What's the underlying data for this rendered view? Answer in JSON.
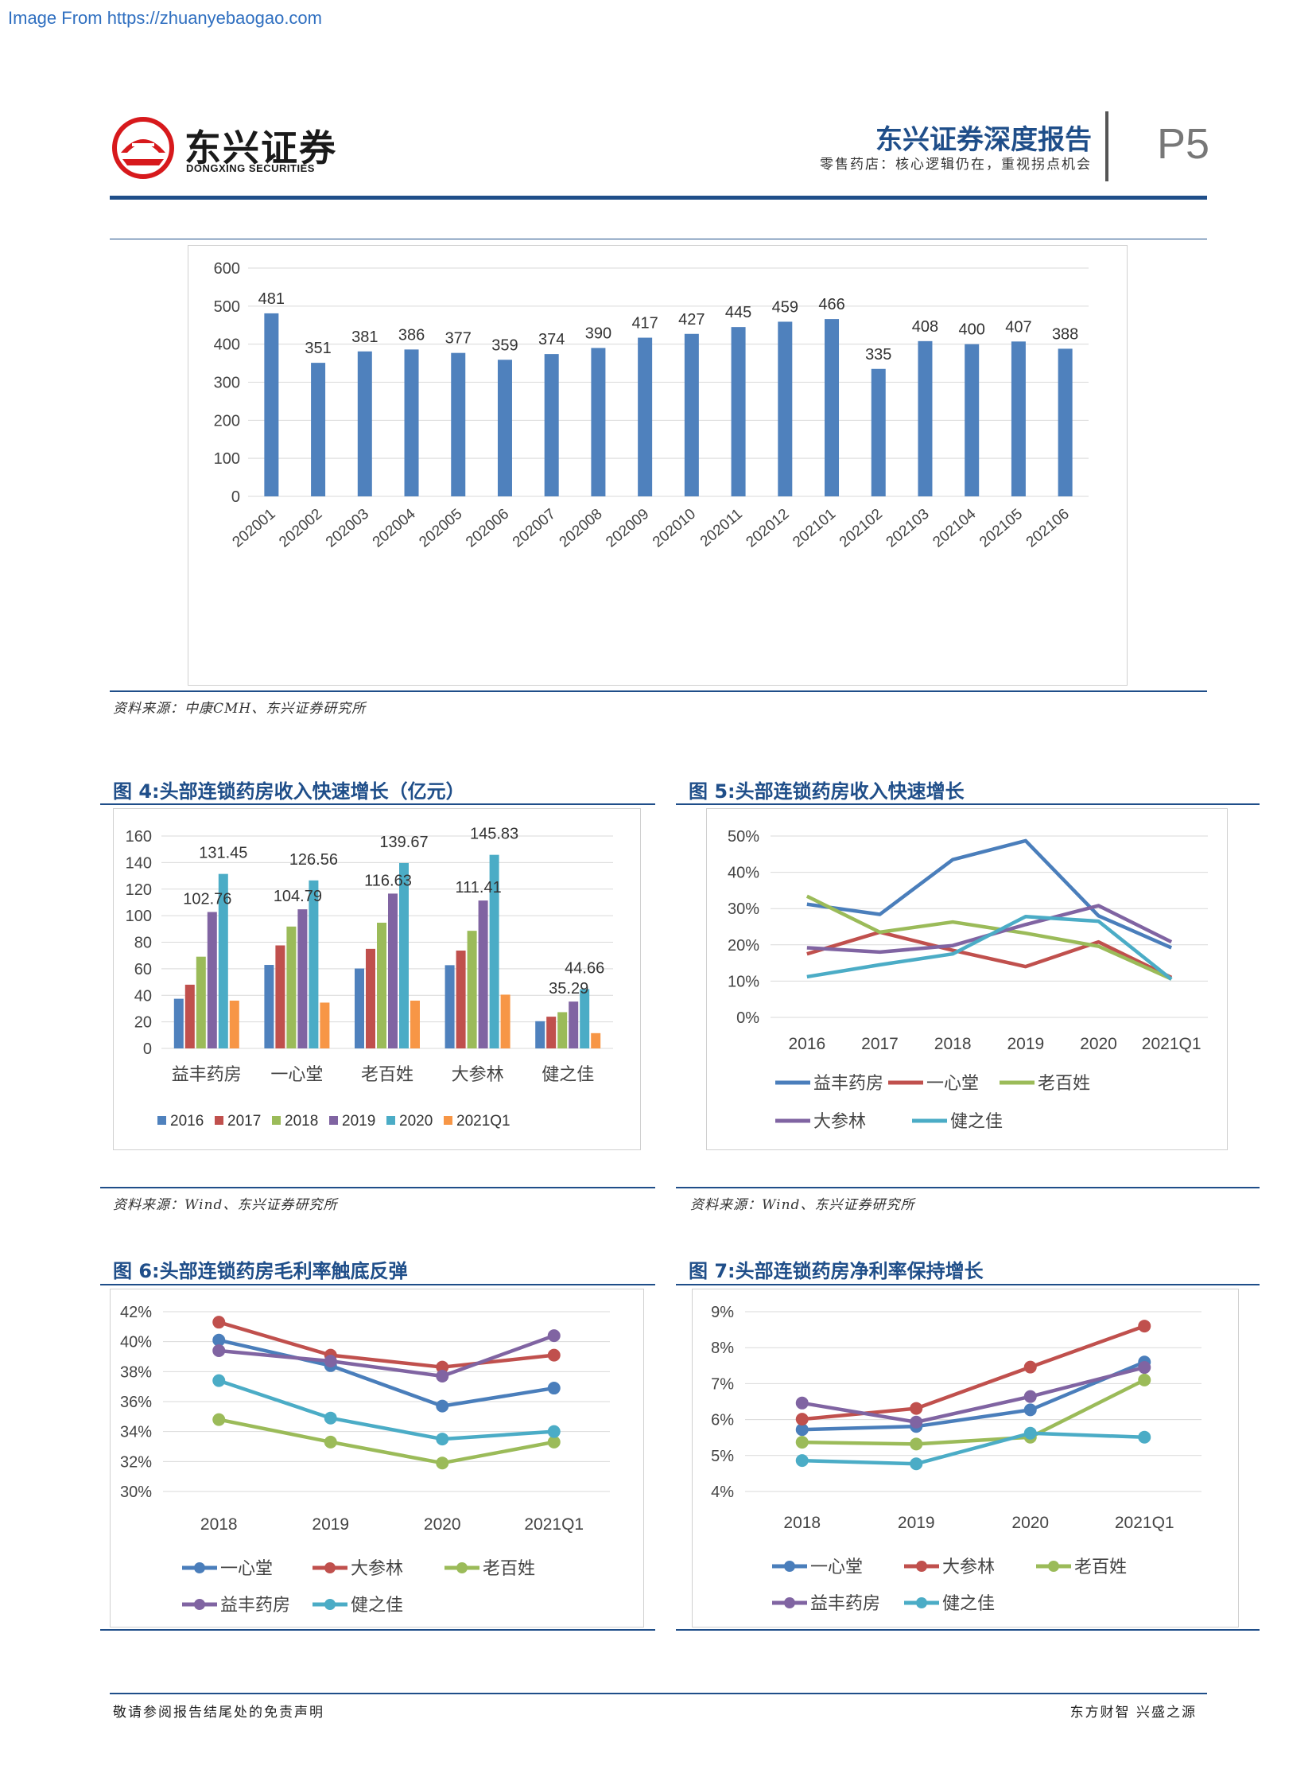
{
  "watermark": "Image From https://zhuanyebaogao.com",
  "header": {
    "logo_cn": "东兴证券",
    "logo_en": "DONGXING SECURITIES",
    "report_title": "东兴证券深度报告",
    "report_subtitle": "零售药店：核心逻辑仍在，重视拐点机会",
    "page": "P5",
    "logo_color": "#d7191c"
  },
  "colors": {
    "accent": "#1f4e89",
    "bar_blue": "#4f81bd",
    "s2016": "#4f81bd",
    "s2017": "#c0504d",
    "s2018": "#9bbb59",
    "s2019": "#8064a2",
    "s2020": "#4bacc6",
    "s2021": "#f79646",
    "line_blue": "#4a7ebb",
    "line_red": "#c0504d",
    "line_green": "#9bbb59",
    "line_purple": "#8064a2",
    "line_teal": "#4bacc6"
  },
  "figures": {
    "fig3": {
      "source": "资料来源：中康CMH、东兴证券研究所"
    },
    "fig4": {
      "title": "图 4:头部连锁药房收入快速增长（亿元）",
      "source": "资料来源：Wind、东兴证券研究所"
    },
    "fig5": {
      "title": "图 5:头部连锁药房收入快速增长",
      "source": "资料来源：Wind、东兴证券研究所"
    },
    "fig6": {
      "title": "图 6:头部连锁药房毛利率触底反弹"
    },
    "fig7": {
      "title": "图 7:头部连锁药房净利率保持增长"
    }
  },
  "footer": {
    "left": "敬请参阅报告结尾处的免责声明",
    "right": "东方财智 兴盛之源"
  },
  "chart_data": [
    {
      "id": "fig3",
      "type": "bar",
      "categories": [
        "202001",
        "202002",
        "202003",
        "202004",
        "202005",
        "202006",
        "202007",
        "202008",
        "202009",
        "202010",
        "202011",
        "202012",
        "202101",
        "202102",
        "202103",
        "202104",
        "202105",
        "202106"
      ],
      "values": [
        481,
        351,
        381,
        386,
        377,
        359,
        374,
        390,
        417,
        427,
        445,
        459,
        466,
        335,
        408,
        400,
        407,
        388
      ],
      "yticks": [
        0,
        100,
        200,
        300,
        400,
        500,
        600
      ],
      "ylim": [
        0,
        600
      ],
      "grid": true,
      "legend": "none"
    },
    {
      "id": "fig4",
      "type": "bar",
      "categories": [
        "益丰药房",
        "一心堂",
        "老百姓",
        "大参林",
        "健之佳"
      ],
      "series": [
        {
          "name": "2016",
          "values": [
            37.4,
            62.9,
            60.2,
            62.7,
            20.5
          ]
        },
        {
          "name": "2017",
          "values": [
            48.0,
            77.6,
            75.0,
            73.7,
            23.9
          ]
        },
        {
          "name": "2018",
          "values": [
            69.1,
            91.8,
            94.7,
            88.6,
            27.3
          ]
        },
        {
          "name": "2019",
          "values": [
            102.76,
            104.79,
            116.63,
            111.41,
            35.29
          ]
        },
        {
          "name": "2020",
          "values": [
            131.45,
            126.56,
            139.67,
            145.83,
            44.66
          ]
        },
        {
          "name": "2021Q1",
          "values": [
            36.0,
            34.5,
            36.0,
            40.5,
            11.5
          ]
        }
      ],
      "data_labels": [
        [
          3,
          0
        ],
        [
          4,
          0
        ],
        [
          3,
          1
        ],
        [
          4,
          1
        ],
        [
          3,
          2
        ],
        [
          4,
          2
        ],
        [
          3,
          3
        ],
        [
          4,
          3
        ],
        [
          3,
          4
        ],
        [
          4,
          4
        ]
      ],
      "yticks": [
        0,
        20,
        40,
        60,
        80,
        100,
        120,
        140,
        160
      ],
      "ylim": [
        0,
        160
      ],
      "legend": "bottom"
    },
    {
      "id": "fig5",
      "type": "line",
      "x": [
        "2016",
        "2017",
        "2018",
        "2019",
        "2020",
        "2021Q1"
      ],
      "series": [
        {
          "name": "益丰药房",
          "values": [
            31.2,
            28.4,
            43.5,
            48.7,
            28.0,
            19.2
          ]
        },
        {
          "name": "一心堂",
          "values": [
            17.5,
            23.5,
            18.5,
            14.0,
            20.8,
            11.0
          ]
        },
        {
          "name": "老百姓",
          "values": [
            33.4,
            23.5,
            26.3,
            23.2,
            19.6,
            10.6
          ]
        },
        {
          "name": "大参林",
          "values": [
            19.2,
            18.0,
            19.8,
            25.6,
            30.8,
            20.8
          ]
        },
        {
          "name": "健之佳",
          "values": [
            11.2,
            14.5,
            17.5,
            27.8,
            26.5,
            10.5
          ]
        }
      ],
      "yticks": [
        "0%",
        "10%",
        "20%",
        "30%",
        "40%",
        "50%"
      ],
      "ylim": [
        0,
        50
      ],
      "legend": "bottom"
    },
    {
      "id": "fig6",
      "type": "line",
      "x": [
        "2018",
        "2019",
        "2020",
        "2021Q1"
      ],
      "series": [
        {
          "name": "一心堂",
          "values": [
            40.1,
            38.4,
            35.7,
            36.9
          ]
        },
        {
          "name": "大参林",
          "values": [
            41.3,
            39.1,
            38.3,
            39.1
          ]
        },
        {
          "name": "老百姓",
          "values": [
            34.8,
            33.3,
            31.9,
            33.3
          ]
        },
        {
          "name": "益丰药房",
          "values": [
            39.4,
            38.7,
            37.7,
            40.4
          ]
        },
        {
          "name": "健之佳",
          "values": [
            37.4,
            34.9,
            33.5,
            34.0
          ]
        }
      ],
      "yticks": [
        "30%",
        "32%",
        "34%",
        "36%",
        "38%",
        "40%",
        "42%"
      ],
      "ylim": [
        30,
        42
      ],
      "legend": "bottom"
    },
    {
      "id": "fig7",
      "type": "line",
      "x": [
        "2018",
        "2019",
        "2020",
        "2021Q1"
      ],
      "series": [
        {
          "name": "一心堂",
          "values": [
            5.72,
            5.81,
            6.27,
            7.6
          ]
        },
        {
          "name": "大参林",
          "values": [
            6.01,
            6.31,
            7.46,
            8.6
          ]
        },
        {
          "name": "老百姓",
          "values": [
            5.37,
            5.32,
            5.51,
            7.1
          ]
        },
        {
          "name": "益丰药房",
          "values": [
            6.46,
            5.93,
            6.64,
            7.45
          ]
        },
        {
          "name": "健之佳",
          "values": [
            4.86,
            4.77,
            5.62,
            5.51
          ]
        }
      ],
      "yticks": [
        "4%",
        "5%",
        "6%",
        "7%",
        "8%",
        "9%"
      ],
      "ylim": [
        4,
        9
      ],
      "legend": "bottom"
    }
  ]
}
